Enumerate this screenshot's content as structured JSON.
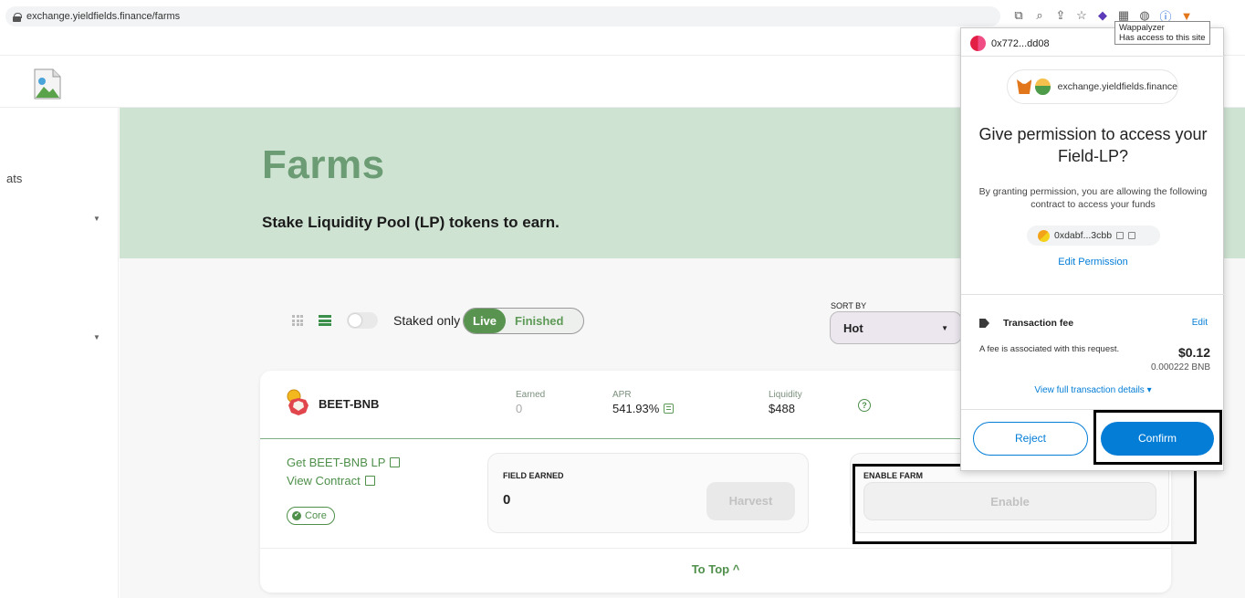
{
  "browser": {
    "url": "exchange.yieldfields.finance/farms",
    "tooltip_title": "Wappalyzer",
    "tooltip_text": "Has access to this site"
  },
  "sidebar": {
    "item_text": "ats"
  },
  "hero": {
    "title": "Farms",
    "subtitle": "Stake Liquidity Pool (LP) tokens to earn."
  },
  "controls": {
    "staked_only_label": "Staked only",
    "live_label": "Live",
    "finished_label": "Finished",
    "sort_by_label": "SORT BY",
    "sort_value": "Hot"
  },
  "farm": {
    "pair": "BEET-BNB",
    "earned_label": "Earned",
    "earned_value": "0",
    "apr_label": "APR",
    "apr_value": "541.93%",
    "liquidity_label": "Liquidity",
    "liquidity_value": "$488",
    "help_glyph": "?",
    "get_lp_link": "Get BEET-BNB LP",
    "view_contract_link": "View Contract",
    "core_badge": "Core",
    "field_earned_label": "FIELD EARNED",
    "field_earned_value": "0",
    "harvest_label": "Harvest",
    "enable_farm_label": "ENABLE FARM",
    "enable_label": "Enable",
    "to_top_label": "To Top ^"
  },
  "wallet": {
    "account": "0x772...dd08",
    "origin": "exchange.yieldfields.finance",
    "title": "Give permission to access your Field-LP?",
    "description": "By granting permission, you are allowing the following contract to access your funds",
    "contract_address": "0xdabf...3cbb",
    "edit_permission": "Edit Permission",
    "fee_title": "Transaction fee",
    "fee_edit": "Edit",
    "fee_description": "A fee is associated with this request.",
    "fee_amount": "$0.12",
    "fee_bnb": "0.000222 BNB",
    "view_details": "View full transaction details",
    "reject_label": "Reject",
    "confirm_label": "Confirm"
  },
  "colors": {
    "brand_green": "#4e8f4a",
    "hero_bg": "#cfe3d3",
    "metamask_blue": "#037dd6"
  }
}
